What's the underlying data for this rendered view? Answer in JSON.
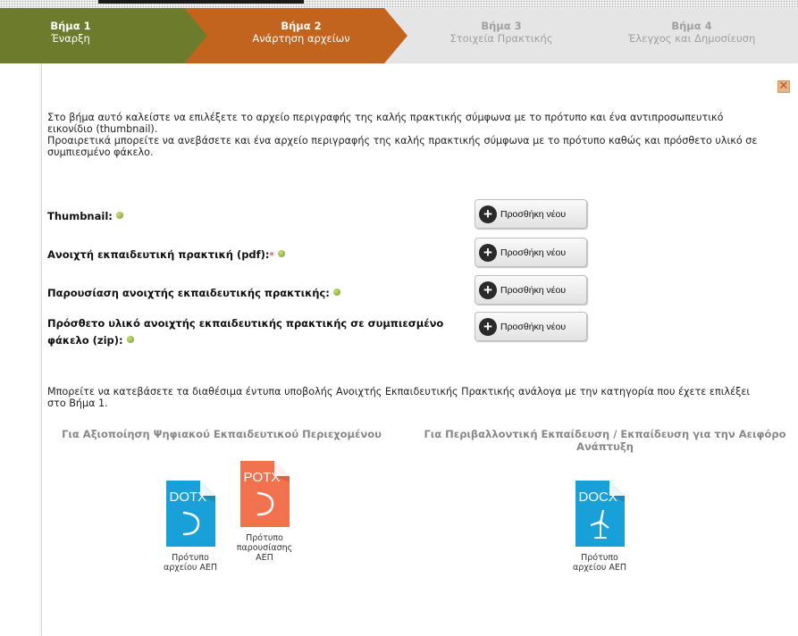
{
  "steps": [
    {
      "num": "Βήμα 1",
      "name": "Έναρξη"
    },
    {
      "num": "Βήμα 2",
      "name": "Ανάρτηση αρχείων"
    },
    {
      "num": "Βήμα 3",
      "name": "Στοιχεία Πρακτικής"
    },
    {
      "num": "Βήμα 4",
      "name": "Έλεγχος και Δημοσίευση"
    }
  ],
  "close": "✕",
  "intro": {
    "line1": "Στο βήμα αυτό καλείστε να επιλέξετε το αρχείο περιγραφής της καλής πρακτικής σύμφωνα με το πρότυπο και ένα αντιπροσωπευτικό εικονίδιο (thumbnail).",
    "line2": "Προαιρετικά μπορείτε να ανεβάσετε και ένα αρχείο περιγραφής της καλής πρακτικής σύμφωνα με το πρότυπο καθώς και πρόσθετο υλικό σε συμπιεσμένο φάκελο."
  },
  "uploads": [
    {
      "label": "Thumbnail:",
      "required": false
    },
    {
      "label": "Ανοιχτή εκπαιδευτική πρακτική (pdf):",
      "required": true
    },
    {
      "label": "Παρουσίαση ανοιχτής εκπαιδευτικής πρακτικής:",
      "required": false
    },
    {
      "label": "Πρόσθετο υλικό ανοιχτής εκπαιδευτικής πρακτικής σε συμπιεσμένο φάκελο (zip):",
      "required": false
    }
  ],
  "add_button_label": "Προσθήκη νέου",
  "required_mark": "*",
  "downloads_text": "Μπορείτε να κατεβάσετε τα διαθέσιμα έντυπα υποβολής Ανοιχτής Εκπαιδευτικής Πρακτικής ανάλογα με την κατηγορία που έχετε επιλέξει στο Βήμα 1.",
  "categories": [
    {
      "title": "Για Αξιοποίηση Ψηφιακού Εκπαιδευτικού Περιεχομένου",
      "files": [
        {
          "type": "DOTX",
          "caption": "Πρότυπο αρχείου ΑΕΠ",
          "color": "#1aa0d8"
        },
        {
          "type": "POTX",
          "caption": "Πρότυπο παρουσίασης ΑΕΠ",
          "color": "#f2724f"
        }
      ]
    },
    {
      "title": "Για Περιβαλλοντική Εκπαίδευση / Εκπαίδευση για την Αειφόρο Ανάπτυξη",
      "files": [
        {
          "type": "DOCX",
          "caption": "Πρότυπο αρχείου ΑΕΠ",
          "color": "#1aa0d8"
        }
      ]
    }
  ],
  "colors": {
    "step_done": "#6d7c2c",
    "step_active": "#c2641e",
    "step_pending": "#e5e5e5",
    "status_dot": "#7b9a2a",
    "required": "#d9534f"
  }
}
